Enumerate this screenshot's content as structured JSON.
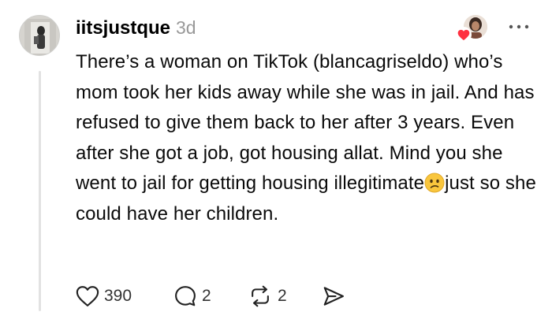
{
  "post": {
    "username": "iitsjustque",
    "timestamp": "3d",
    "text_segments": {
      "before_emoji": "There’s a woman on TikTok (blancagriseldo) who’s mom took her kids away while she was in jail. And has refused to give them back to her after 3 years. Even after she got a job, got housing allat. Mind you she went to jail for getting housing  illegitimate",
      "after_emoji": "just so she could have her children."
    },
    "emoji": "confused-face"
  },
  "actions": {
    "likes": "390",
    "replies": "2",
    "reposts": "2"
  },
  "icons": {
    "avatar": "user-avatar",
    "liker": "liked-by-avatar",
    "more": "more-options-icon",
    "like": "heart-icon",
    "reply": "comment-bubble-icon",
    "repost": "repost-icon",
    "share": "send-icon"
  },
  "colors": {
    "like_heart_badge": "#ff3040",
    "timestamp": "#999999",
    "thread_line": "#e2e2e2",
    "emoji_face": "#f9c63d"
  }
}
